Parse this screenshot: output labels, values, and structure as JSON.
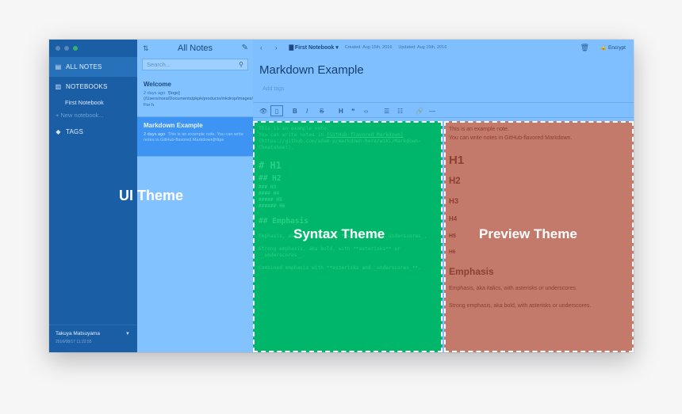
{
  "sidebar": {
    "all_notes": "ALL NOTES",
    "notebooks": "NOTEBOOKS",
    "notebook_first": "First Notebook",
    "new_notebook": "+ New notebook...",
    "tags": "TAGS",
    "user_name": "Takuya Matsuyama",
    "user_date": "2016/08/17 11:22:55"
  },
  "labels": {
    "ui_theme": "UI Theme",
    "syntax_theme": "Syntax Theme",
    "preview_theme": "Preview Theme"
  },
  "notes_list": {
    "header": "All Notes",
    "search_placeholder": "Search...",
    "notes": [
      {
        "title": "Welcome",
        "age": "2 days ago",
        "snippet": "![logo](/Users/nora/Documents/pkpk/products/inkdrop/images/banner_sm.png) For h"
      },
      {
        "title": "Markdown Example",
        "age": "2 days ago",
        "snippet": "This is an example note. You can write notes in GitHub-flavored Markdown[https"
      }
    ]
  },
  "editor": {
    "notebook": "First Notebook",
    "created": "Created: Aug 15th, 2016",
    "updated": "Updated: Aug 15th, 2016",
    "encrypt": "Encrypt",
    "title": "Markdown Example",
    "tags_placeholder": "Add tags",
    "toolbar": [
      "👁",
      "▯",
      "B",
      "I",
      "S",
      "H",
      "❝",
      "‹›",
      "☰",
      "☷",
      "🔗",
      "—"
    ]
  },
  "syntax": {
    "l1": "This is an example note.",
    "l2a": "You can write notes in ",
    "l2b": "[GitHub-flavored Markdown]",
    "l3": "(https://github.com/adam-p/markdown-here/wiki/Markdown-Cheatsheet).",
    "h1": "# H1",
    "h2": "## H2",
    "h3": "### H3",
    "h4": "#### H4",
    "h5": "##### H5",
    "h6": "###### H6",
    "emph": "## Emphasis",
    "e1": "Emphasis, aka italics, with *asterisks* or _underscores_.",
    "e2": "Strong emphasis, aka bold, with **asterisks** or __underscores__.",
    "e3": "Combined emphasis with **asterisks and _underscores_**."
  },
  "preview": {
    "l1": "This is an example note.",
    "l2": "You can write notes in GitHub-flavored Markdown.",
    "h1": "H1",
    "h2": "H2",
    "h3": "H3",
    "h4": "H4",
    "h5": "H5",
    "h6": "H6",
    "emph": "Emphasis",
    "p1": "Emphasis, aka italics, with asterisks or underscores.",
    "p2": "Strong emphasis, aka bold, with asterisks or underscores."
  }
}
